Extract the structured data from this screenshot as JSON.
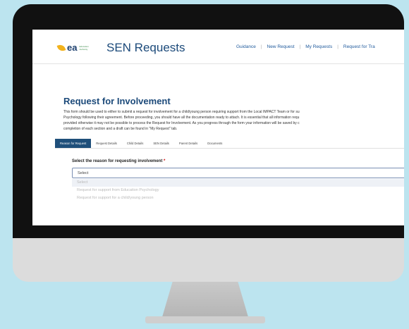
{
  "header": {
    "logo_text": "ea",
    "logo_org": "Education Authority",
    "app_title": "SEN Requests",
    "nav": [
      "Guidance",
      "New Request",
      "My Requests",
      "Request for Tra"
    ]
  },
  "page": {
    "title": "Request for Involvement",
    "intro": "This form should be used to either to submit a request for involvement for a child/young person requiring support from the Local IMPACT Team or for su\nPsychology following their agreement. Before proceeding, you should have all the documentation ready to attach. It is essential that all information requ\nprovided otherwise it may not be possible to process the Request for Involvement. As you progress through the form your information will be saved by c\ncompletion of each section and a draft can be found in \"My Request\" tab."
  },
  "tabs": [
    "Reason for Request",
    "Request Details",
    "Child Details",
    "SEN Details",
    "Parent Details",
    "Documents"
  ],
  "form": {
    "label": "Select the reason for requesting involvement",
    "required_mark": "*",
    "select_value": "Select",
    "options": [
      "Select",
      "Request for support from Education Psychology",
      "Request for support for a child/young person"
    ]
  },
  "colors": {
    "background": "#bce4ef",
    "accent": "#1f4f7a",
    "title": "#1c4a7a"
  }
}
